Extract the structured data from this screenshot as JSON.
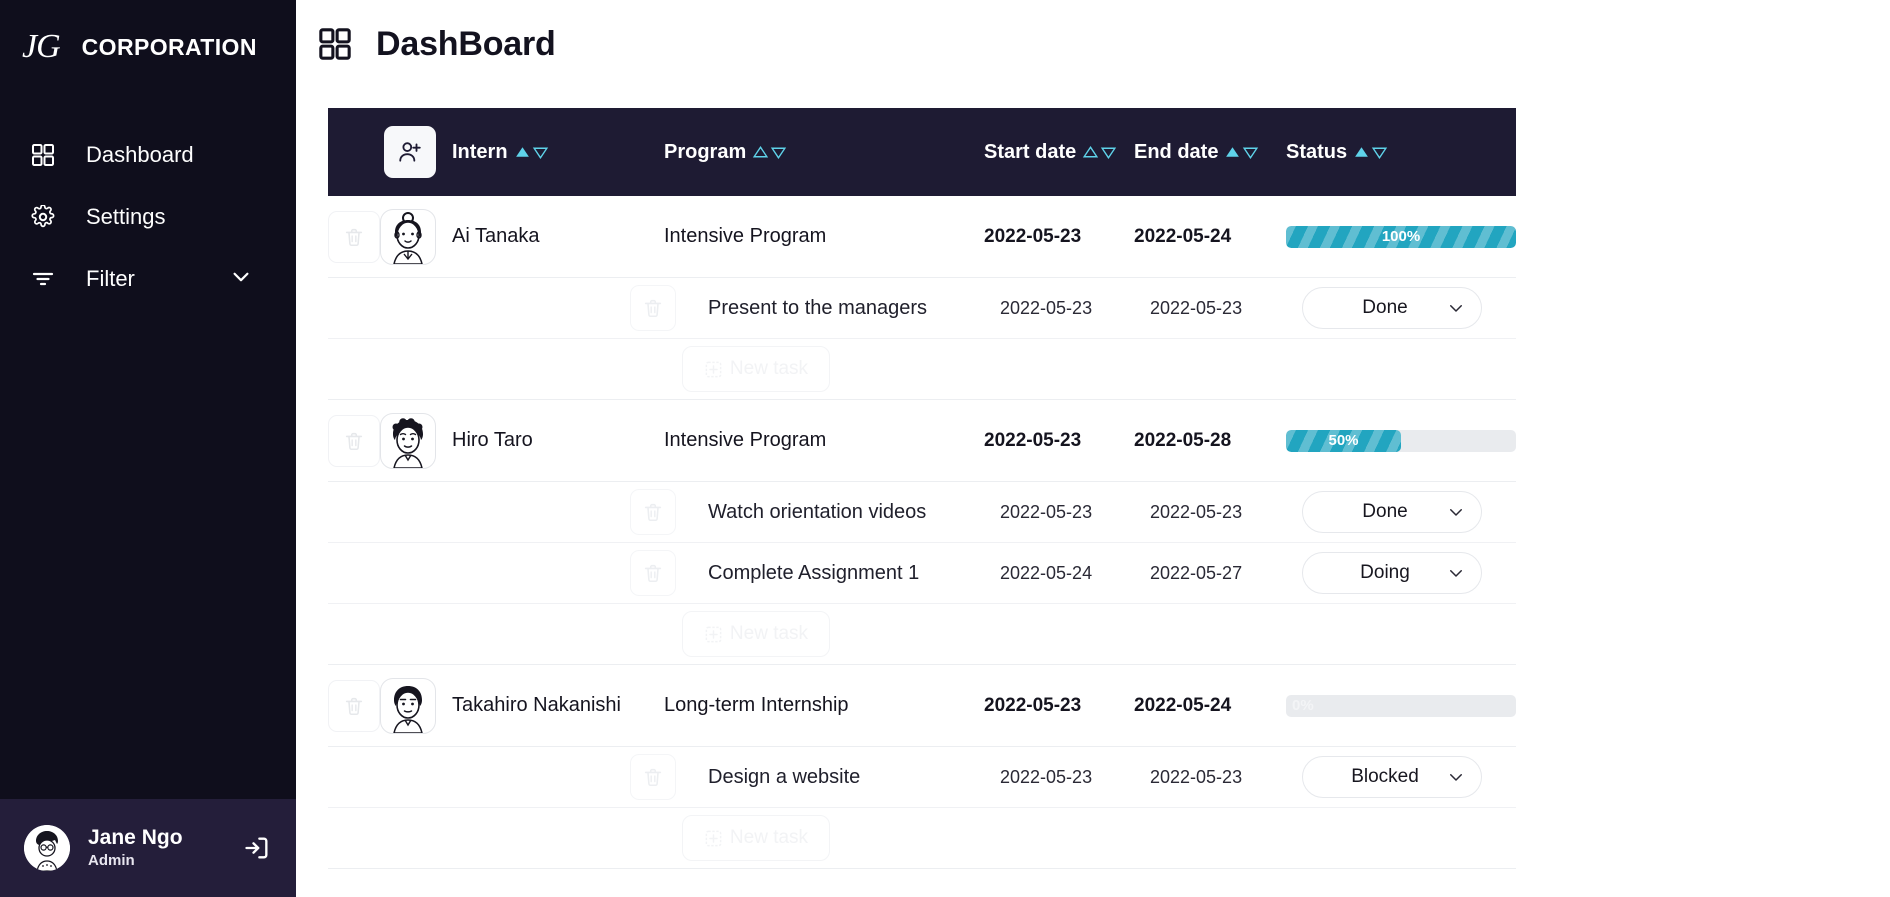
{
  "sidebar": {
    "brand": {
      "logo": "JG",
      "name": "CORPORATION"
    },
    "items": [
      {
        "label": "Dashboard",
        "icon": "grid-icon"
      },
      {
        "label": "Settings",
        "icon": "gear-icon"
      },
      {
        "label": "Filter",
        "icon": "filter-icon",
        "chevron": "chevron-down-icon"
      }
    ],
    "profile": {
      "name": "Jane Ngo",
      "role": "Admin",
      "logout_icon": "logout-icon"
    }
  },
  "header": {
    "title": "DashBoard",
    "icon": "grid-icon"
  },
  "table": {
    "add_user_icon": "user-plus-icon",
    "columns": [
      {
        "label": "Intern",
        "sort_asc": true,
        "sort_desc": false
      },
      {
        "label": "Program",
        "sort_asc": false,
        "sort_desc": false
      },
      {
        "label": "Start date",
        "sort_asc": false,
        "sort_desc": false
      },
      {
        "label": "End date",
        "sort_asc": true,
        "sort_desc": false
      },
      {
        "label": "Status",
        "sort_asc": true,
        "sort_desc": false
      }
    ],
    "new_task_label": "New task",
    "status_options": [
      "Done",
      "Doing",
      "Blocked"
    ],
    "rows": [
      {
        "name": "Ai Tanaka",
        "program": "Intensive Program",
        "start": "2022-05-23",
        "end": "2022-05-24",
        "progress": 100,
        "progress_label": "100%",
        "tasks": [
          {
            "name": "Present to the managers",
            "start": "2022-05-23",
            "end": "2022-05-23",
            "status": "Done"
          }
        ]
      },
      {
        "name": "Hiro Taro",
        "program": "Intensive Program",
        "start": "2022-05-23",
        "end": "2022-05-28",
        "progress": 50,
        "progress_label": "50%",
        "tasks": [
          {
            "name": "Watch orientation videos",
            "start": "2022-05-23",
            "end": "2022-05-23",
            "status": "Done"
          },
          {
            "name": "Complete Assignment 1",
            "start": "2022-05-24",
            "end": "2022-05-27",
            "status": "Doing"
          }
        ]
      },
      {
        "name": "Takahiro Nakanishi",
        "program": "Long-term Internship",
        "start": "2022-05-23",
        "end": "2022-05-24",
        "progress": 0,
        "progress_label": "0%",
        "tasks": [
          {
            "name": "Design a website",
            "start": "2022-05-23",
            "end": "2022-05-23",
            "status": "Blocked"
          }
        ]
      }
    ]
  },
  "colors": {
    "sidebar_bg": "#0f0e1c",
    "profile_bg": "#241e3a",
    "table_header_bg": "#1e1b33",
    "accent_teal": "#22a5c0",
    "sort_cyan": "#5fd3ea",
    "track_gray": "#e9ebee"
  }
}
